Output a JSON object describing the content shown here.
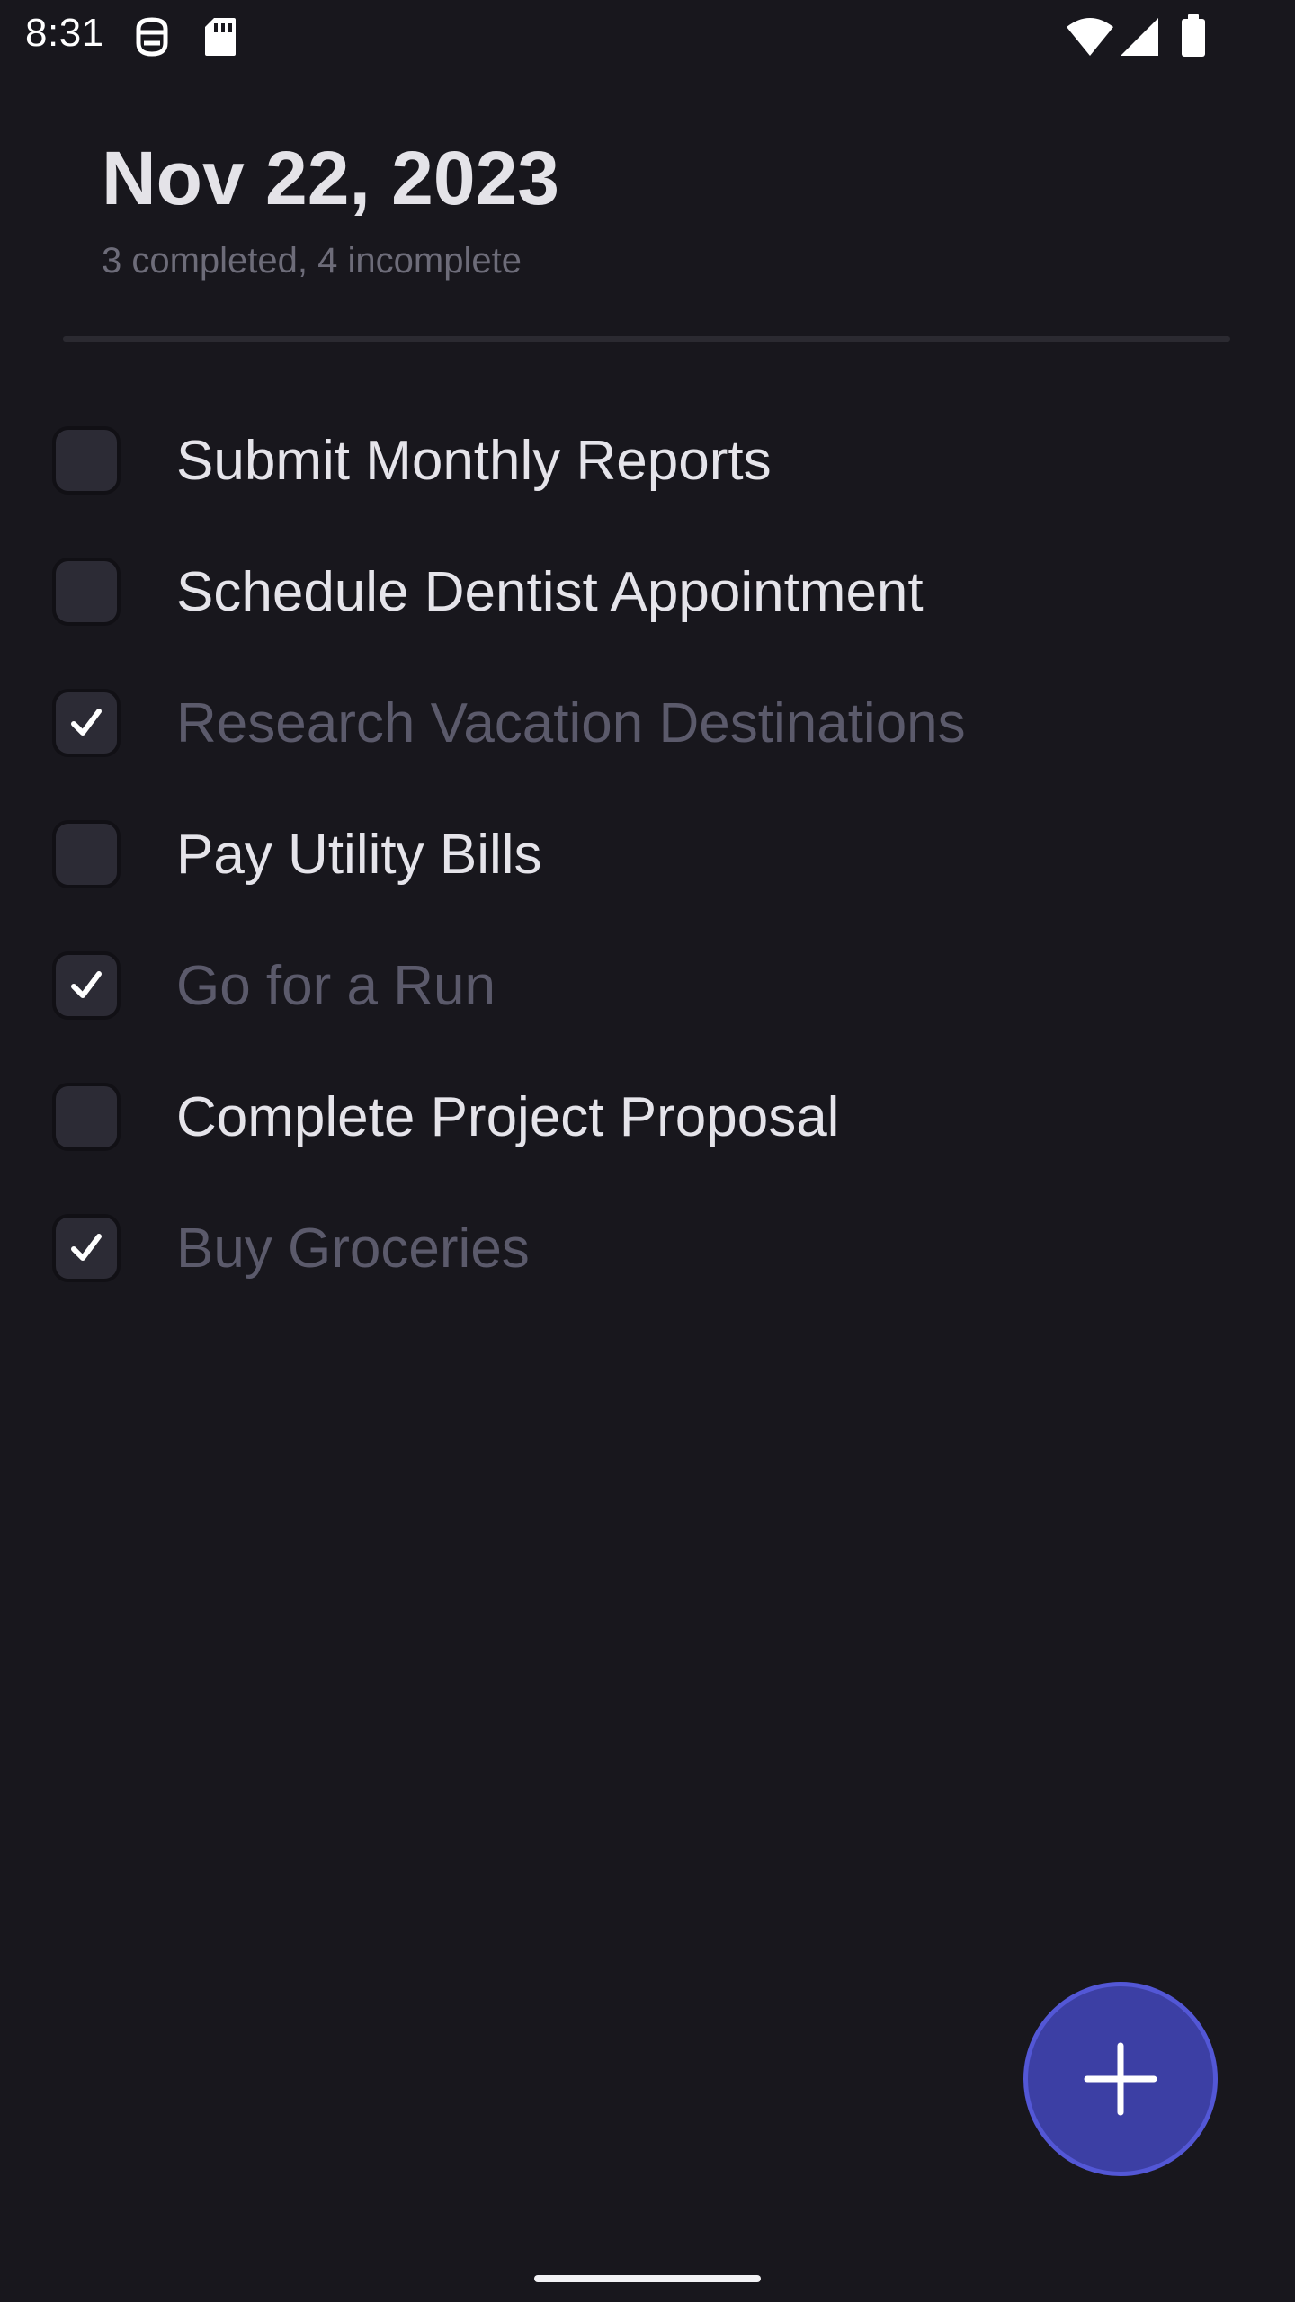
{
  "status_bar": {
    "time": "8:31",
    "icons": [
      "notification-face-icon",
      "sd-card-icon",
      "wifi-icon",
      "cellular-signal-icon",
      "battery-icon"
    ]
  },
  "header": {
    "date": "Nov 22, 2023",
    "summary": "3 completed, 4 incomplete"
  },
  "tasks": [
    {
      "label": "Submit Monthly Reports",
      "completed": false
    },
    {
      "label": "Schedule Dentist Appointment",
      "completed": false
    },
    {
      "label": "Research Vacation Destinations",
      "completed": true
    },
    {
      "label": "Pay Utility Bills",
      "completed": false
    },
    {
      "label": "Go for a Run",
      "completed": true
    },
    {
      "label": "Complete Project Proposal",
      "completed": false
    },
    {
      "label": "Buy Groceries",
      "completed": true
    }
  ],
  "fab": {
    "icon": "plus-icon"
  },
  "colors": {
    "background": "#18171d",
    "accent": "#3c3fa4",
    "completed_text": "#5b5a6b",
    "text": "#e5e4ea"
  }
}
